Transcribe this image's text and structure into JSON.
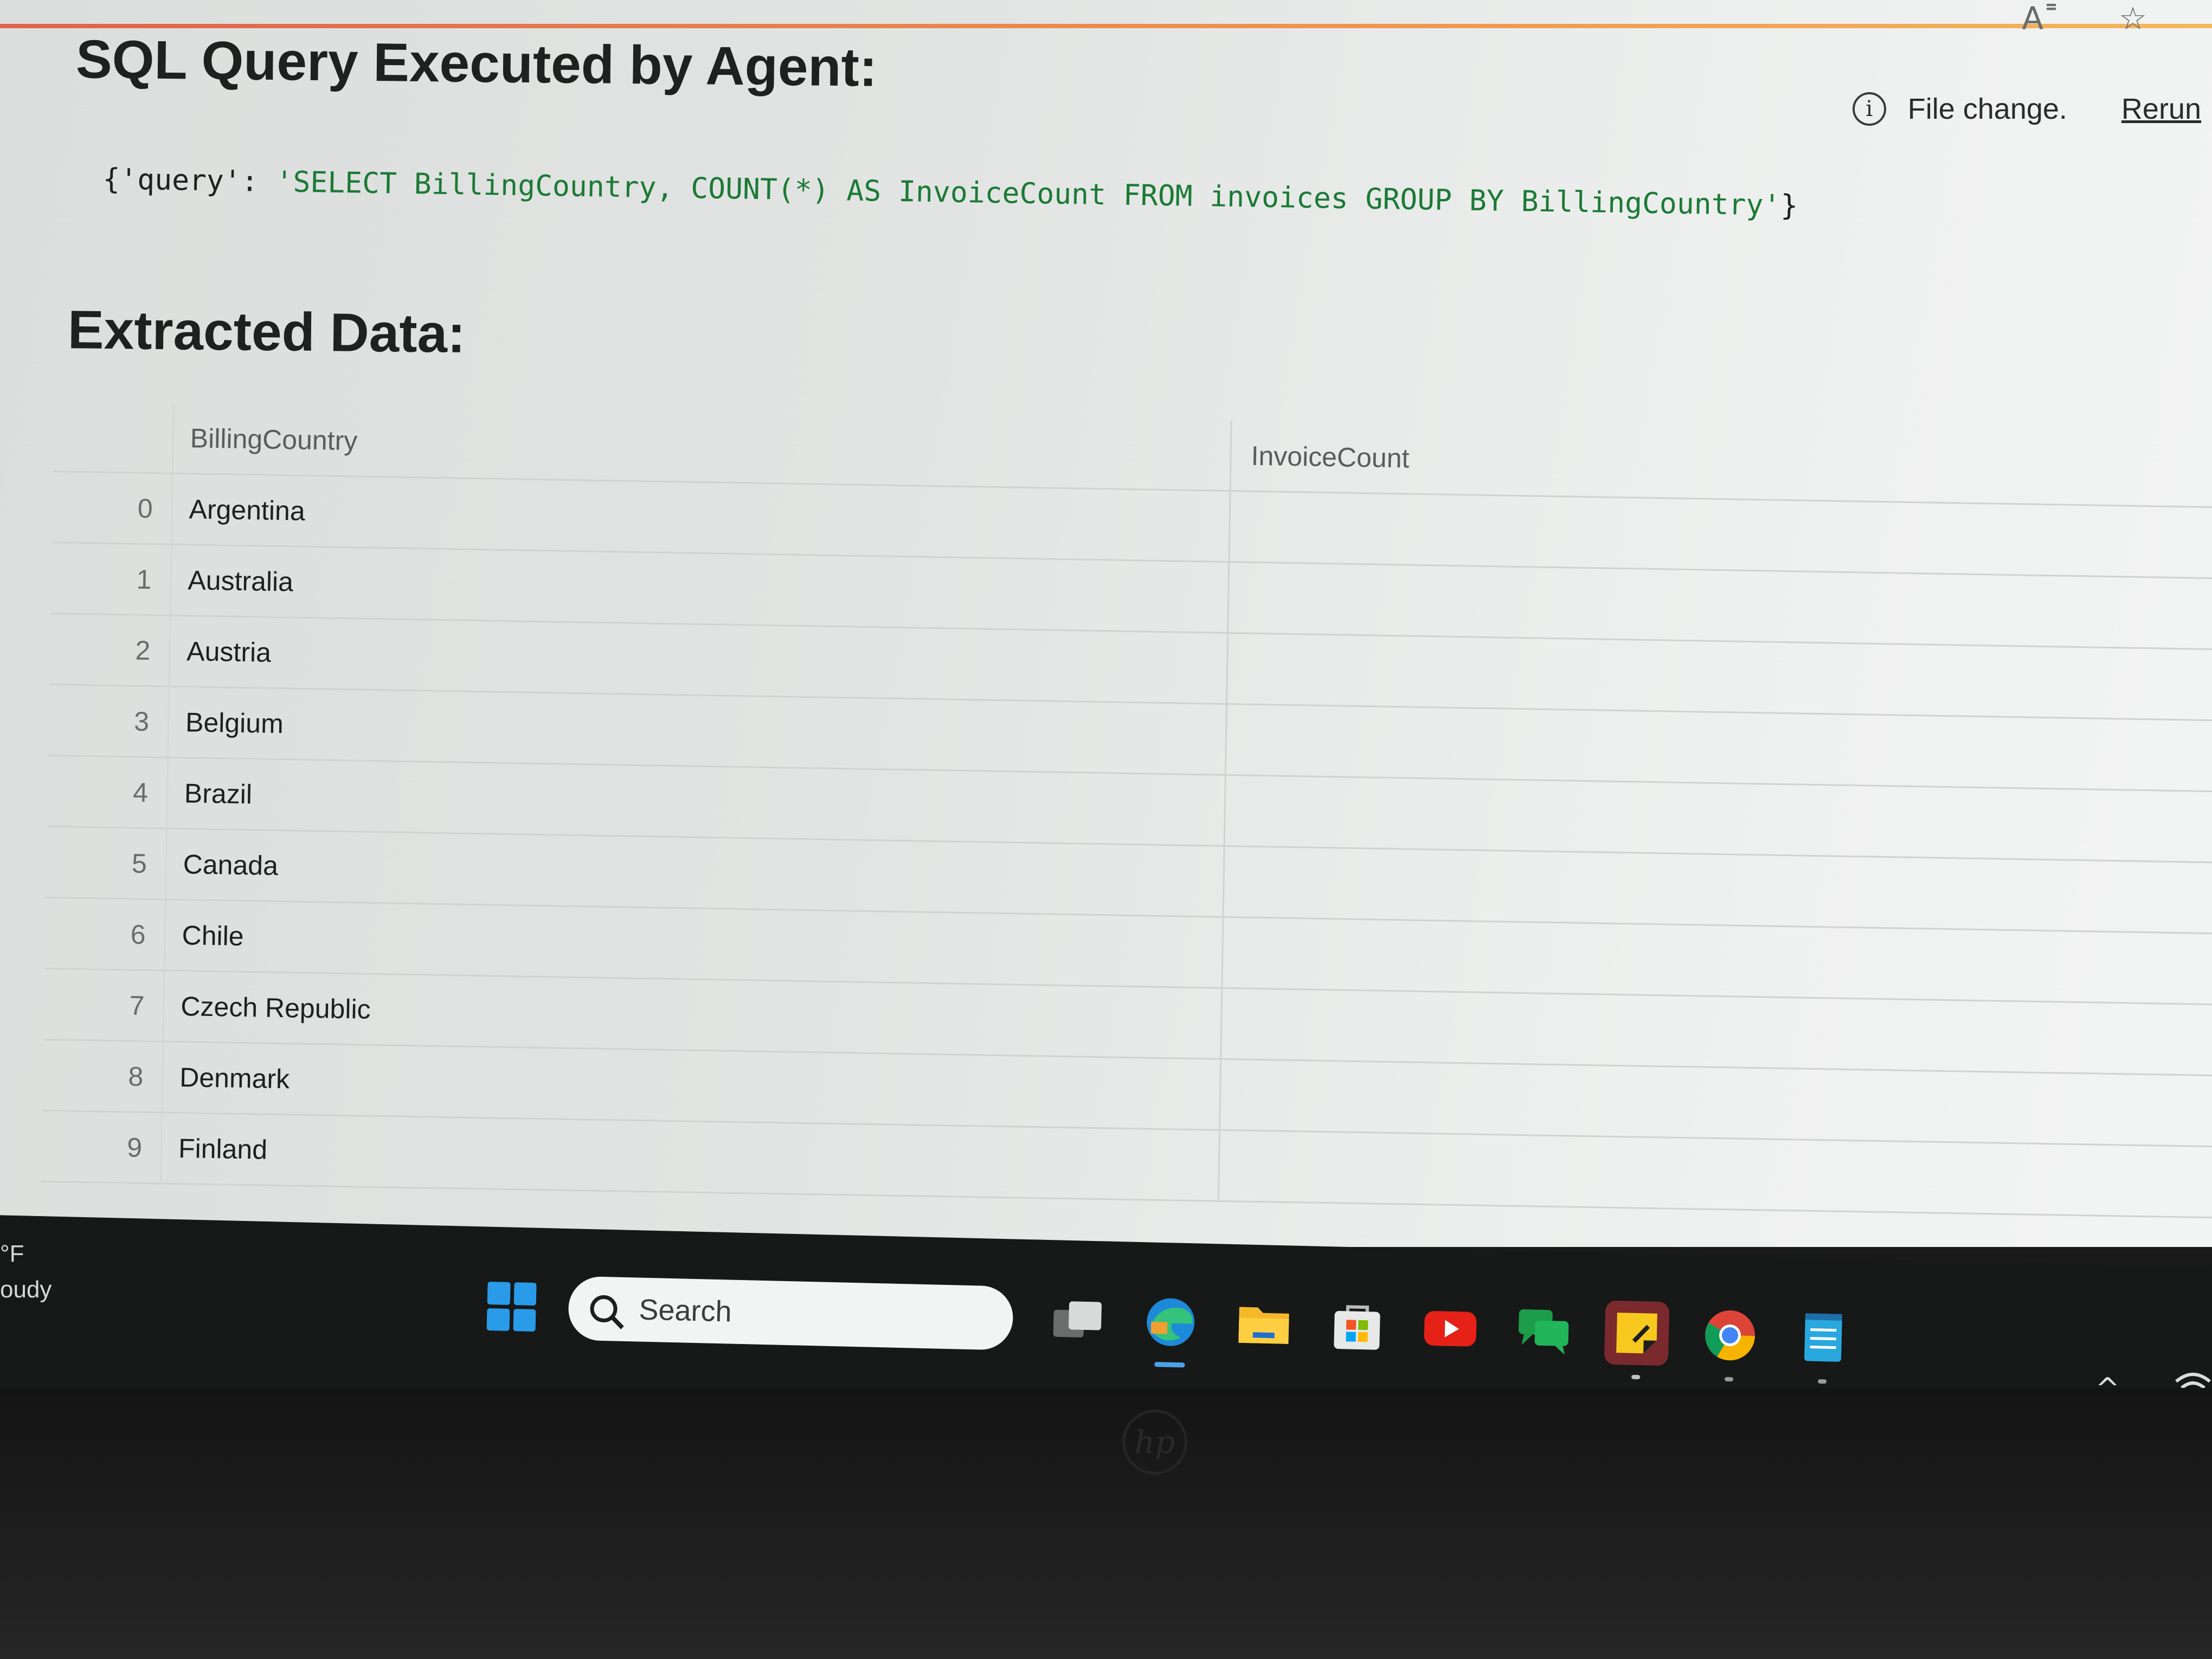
{
  "browser": {
    "read_aloud_icon": "A˭",
    "favorite_icon": "☆"
  },
  "status": {
    "info_icon": "i",
    "message": "File change.",
    "rerun_label": "Rerun"
  },
  "query_section": {
    "title": "SQL Query Executed by Agent:",
    "open": "{'query': ",
    "query_string": "'SELECT BillingCountry, COUNT(*) AS InvoiceCount FROM invoices GROUP BY BillingCountry'",
    "close": "}"
  },
  "data_section": {
    "title": "Extracted Data:",
    "columns": [
      "",
      "BillingCountry",
      "InvoiceCount"
    ],
    "rows": [
      {
        "index": "0",
        "country": "Argentina",
        "count": ""
      },
      {
        "index": "1",
        "country": "Australia",
        "count": ""
      },
      {
        "index": "2",
        "country": "Austria",
        "count": ""
      },
      {
        "index": "3",
        "country": "Belgium",
        "count": ""
      },
      {
        "index": "4",
        "country": "Brazil",
        "count": ""
      },
      {
        "index": "5",
        "country": "Canada",
        "count": ""
      },
      {
        "index": "6",
        "country": "Chile",
        "count": ""
      },
      {
        "index": "7",
        "country": "Czech Republic",
        "count": ""
      },
      {
        "index": "8",
        "country": "Denmark",
        "count": ""
      },
      {
        "index": "9",
        "country": "Finland",
        "count": ""
      }
    ]
  },
  "taskbar": {
    "weather_temp_unit": "°F",
    "weather_condition": "oudy",
    "search_placeholder": "Search",
    "icons": [
      "start-icon",
      "task-view-icon",
      "edge-icon",
      "file-explorer-icon",
      "microsoft-store-icon",
      "youtube-icon",
      "chat-icon",
      "sticky-notes-icon",
      "chrome-icon",
      "notepad-icon"
    ],
    "tray_chevron": "^",
    "wifi_icon": "wifi"
  },
  "colors": {
    "accent_top": "#e0543a",
    "code_string": "#1b7a35",
    "taskbar_bg": "#171818",
    "active_app_bg": "#7a2a2c"
  }
}
